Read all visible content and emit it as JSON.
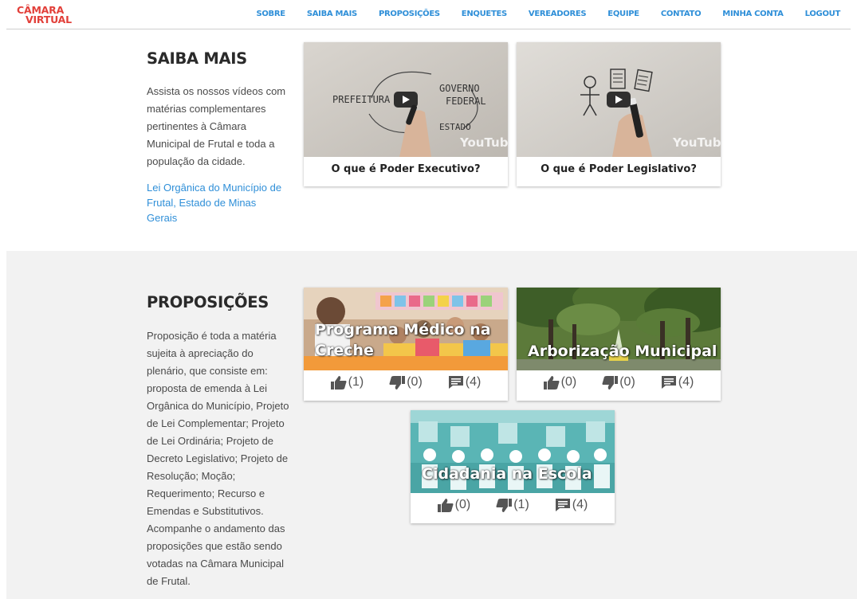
{
  "logo": {
    "line1": "CÂMARA",
    "line2": "VIRTUAL"
  },
  "nav": [
    "SOBRE",
    "SAIBA MAIS",
    "PROPOSIÇÕES",
    "ENQUETES",
    "VEREADORES",
    "EQUIPE",
    "CONTATO",
    "MINHA CONTA",
    "LOGOUT"
  ],
  "saiba": {
    "title": "SAIBA MAIS",
    "text": "Assista os nossos vídeos com matérias complementares pertinentes à Câmara Municipal de Frutal e toda a população da cidade.",
    "link": "Lei Orgânica do Município de Frutal, Estado de Minas Gerais",
    "videos": [
      {
        "caption": "O que é Poder Executivo?",
        "board": [
          "PREFEITURA",
          "GOVERNO",
          "FEDERAL",
          "ESTADO"
        ],
        "badge": "YouTube"
      },
      {
        "caption": "O que é Poder Legislativo?",
        "badge": "YouTube"
      }
    ]
  },
  "proposicoes": {
    "title": "PROPOSIÇÕES",
    "text": "Proposição é toda a matéria sujeita à apreciação do plenário, que consiste em: proposta de emenda à Lei Orgânica do Município, Projeto de Lei Complementar; Projeto de Lei Ordinária; Projeto de Decreto Legislativo; Projeto de Resolução; Moção; Requerimento; Recurso e Emendas e Substitutivos. Acompanhe o andamento das proposições que estão sendo votadas na Câmara Municipal de Frutal.",
    "cards": [
      {
        "title_line1": "Programa Médico na",
        "title_line2": "Creche",
        "likes": "(1)",
        "dislikes": "(0)",
        "comments": "(4)"
      },
      {
        "title_line1": "Arborização Municipal",
        "title_line2": "",
        "likes": "(0)",
        "dislikes": "(0)",
        "comments": "(4)"
      },
      {
        "title_line1": "Cidadania na Escola",
        "title_line2": "",
        "likes": "(0)",
        "dislikes": "(1)",
        "comments": "(4)"
      }
    ]
  },
  "colors": {
    "brand_red": "#e2403a",
    "link_blue": "#2f8fd8",
    "section_gray": "#f2f2f2",
    "icon_gray": "#555555"
  },
  "icons": [
    "thumbs-up-icon",
    "thumbs-down-icon",
    "comment-icon",
    "play-icon"
  ]
}
